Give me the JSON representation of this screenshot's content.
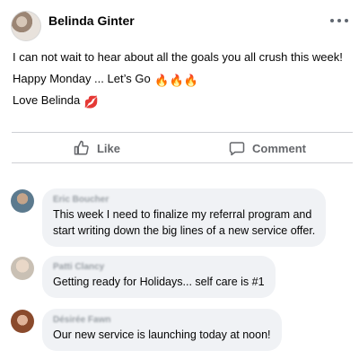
{
  "post": {
    "author": "Belinda Ginter",
    "more_icon": "more-horizontal-icon",
    "lines": [
      "I can not wait to hear about all the goals you all crush this week!",
      "Happy Monday ... Let’s Go",
      "Love Belinda"
    ],
    "fire_emojis": "🔥🔥🔥",
    "kiss_emoji": "💋"
  },
  "actions": {
    "like_label": "Like",
    "comment_label": "Comment",
    "like_icon": "thumbs-up-icon",
    "comment_icon": "speech-bubble-icon"
  },
  "comments": [
    {
      "name": "Eric Boucher",
      "text_lines": [
        "This week I need to finalize my referral program and",
        "start writing down the big lines of a new service offer."
      ]
    },
    {
      "name": "Patti Clancy",
      "text_lines": [
        "Getting ready for Holidays... self care is #1"
      ]
    },
    {
      "name": "Désirée Fawn",
      "text_lines": [
        "Our new service is launching today at noon!"
      ]
    }
  ],
  "colors": {
    "text": "#050505",
    "secondary_text": "#65676b",
    "bubble": "#f0f2f5",
    "divider": "#ced0d4"
  }
}
